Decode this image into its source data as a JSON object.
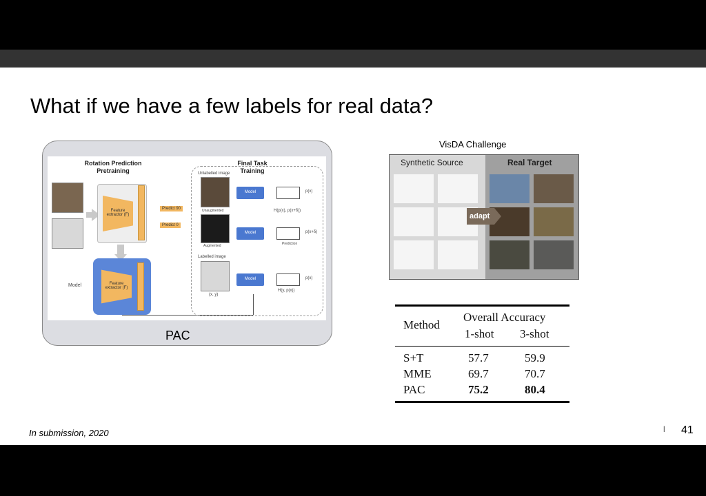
{
  "slide": {
    "title": "What if we have a few labels for real data?",
    "footer_left": "In submission, 2020",
    "footer_mark": "l",
    "page_number": "41"
  },
  "diagram": {
    "caption": "PAC",
    "heading_left": "Rotation Prediction\nPretraining",
    "heading_right": "Final Task\nTraining",
    "feature_extractor": "Feature\nextractor (F)",
    "predict_90": "Predict 90",
    "predict_0": "Predict 0",
    "model_label": "Model",
    "unlabelled_image": "Unlabelled image",
    "unaugmented": "Unaugmented",
    "augmented": "Augmented",
    "labelled_image": "Labelled image",
    "xy": "(x, y)",
    "model_box": "Model",
    "px": "p(x)",
    "pxd": "p(x+δ)",
    "h1": "H(p(x), p(x+δ))",
    "prediction": "Prediction",
    "h2": "H(y, p(x))",
    "px2": "p(x)"
  },
  "visda": {
    "title": "VisDA Challenge",
    "synthetic": "Synthetic Source",
    "real": "Real Target",
    "adapt": "adapt"
  },
  "table": {
    "method_header": "Method",
    "overall_header": "Overall Accuracy",
    "col1": "1-shot",
    "col2": "3-shot",
    "rows": [
      {
        "method": "S+T",
        "one": "57.7",
        "three": "59.9"
      },
      {
        "method": "MME",
        "one": "69.7",
        "three": "70.7"
      },
      {
        "method": "PAC",
        "one": "75.2",
        "three": "80.4"
      }
    ]
  }
}
